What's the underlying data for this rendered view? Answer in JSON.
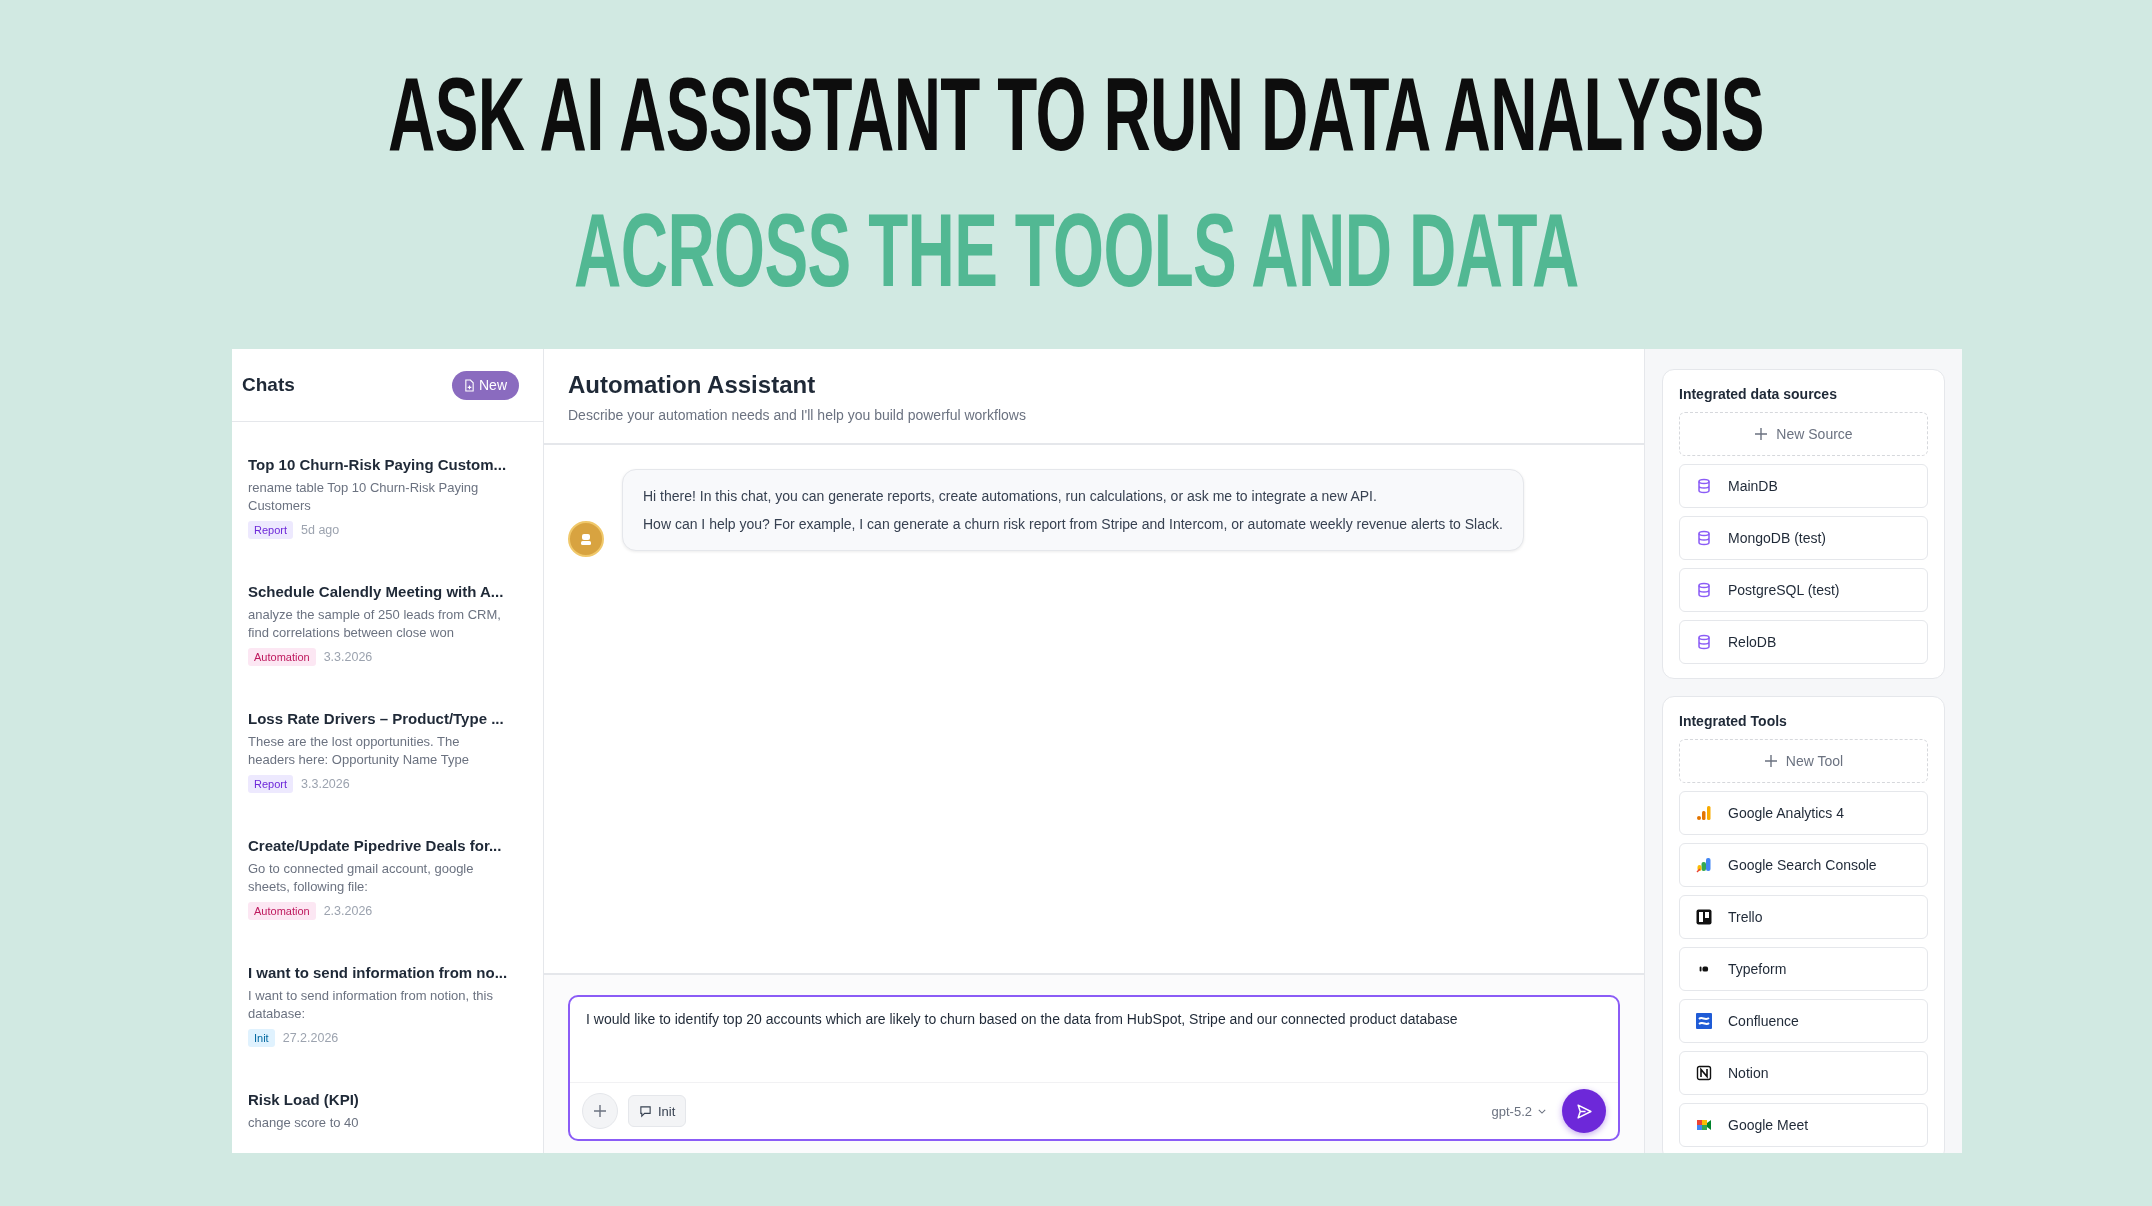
{
  "headline": {
    "line_1": "ASK AI ASSISTANT TO RUN DATA ANALYSIS",
    "line_2": "ACROSS THE TOOLS AND DATA"
  },
  "sidebar": {
    "title": "Chats",
    "new_button": "New",
    "chats": [
      {
        "title": "Top 10 Churn-Risk Paying Custom...",
        "preview": "rename table Top 10 Churn-Risk Paying Customers",
        "tag": {
          "label": "Report",
          "kind": "report"
        },
        "date": "5d ago"
      },
      {
        "title": "Schedule Calendly Meeting with A...",
        "preview": "analyze the sample of 250 leads from CRM, find correlations between close won",
        "tag": {
          "label": "Automation",
          "kind": "automation"
        },
        "date": "3.3.2026"
      },
      {
        "title": "Loss Rate Drivers – Product/Type ...",
        "preview": "These are the lost opportunities. The headers here: Opportunity Name Type",
        "tag": {
          "label": "Report",
          "kind": "report"
        },
        "date": "3.3.2026"
      },
      {
        "title": "Create/Update Pipedrive Deals for...",
        "preview": "Go to connected gmail account, google sheets, following file:",
        "tag": {
          "label": "Automation",
          "kind": "automation"
        },
        "date": "2.3.2026"
      },
      {
        "title": "I want to send information from no...",
        "preview": "I want to send information from notion, this database:",
        "tag": {
          "label": "Init",
          "kind": "init"
        },
        "date": "27.2.2026"
      },
      {
        "title": "Risk Load (KPI)",
        "preview": "change score to 40"
      }
    ]
  },
  "main": {
    "title": "Automation Assistant",
    "subtitle": "Describe your automation needs and I'll help you build powerful workflows",
    "messages": [
      {
        "lines": [
          "Hi there! In this chat, you can generate reports, create automations, run calculations, or ask me to integrate a new API.",
          "How can I help you? For example, I can generate a churn risk report from Stripe and Intercom, or automate weekly revenue alerts to Slack."
        ]
      }
    ],
    "composer": {
      "value": "I would like to identify top 20 accounts which are likely to churn based on the data from HubSpot, Stripe and our connected product database",
      "mode_button": "Init",
      "model": "gpt-5.2"
    }
  },
  "right_panel": {
    "data_sources": {
      "title": "Integrated data sources",
      "add_button": "New Source",
      "items": [
        {
          "name": "MainDB"
        },
        {
          "name": "MongoDB (test)"
        },
        {
          "name": "PostgreSQL (test)"
        },
        {
          "name": "ReloDB"
        }
      ]
    },
    "tools": {
      "title": "Integrated Tools",
      "add_button": "New Tool",
      "items": [
        {
          "name": "Google Analytics 4",
          "kind": "analytics"
        },
        {
          "name": "Google Search Console",
          "kind": "search_console"
        },
        {
          "name": "Trello",
          "kind": "trello"
        },
        {
          "name": "Typeform",
          "kind": "typeform"
        },
        {
          "name": "Confluence",
          "kind": "confluence"
        },
        {
          "name": "Notion",
          "kind": "notion"
        },
        {
          "name": "Google Meet",
          "kind": "meet"
        }
      ]
    }
  }
}
